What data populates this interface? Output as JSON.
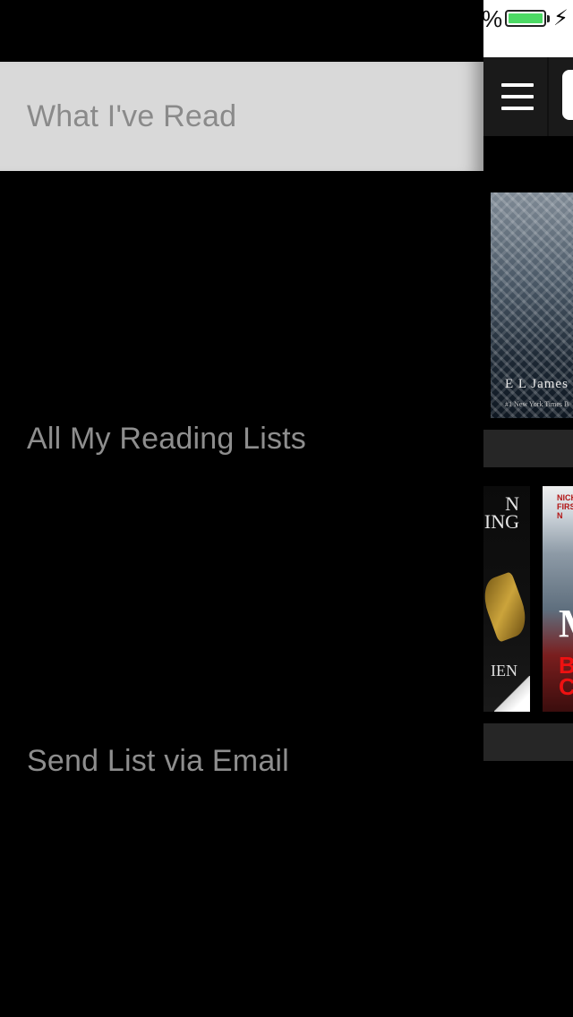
{
  "status_bar": {
    "battery_percent_fragment": "%",
    "battery_color": "#4cd964",
    "charging_icon": "bolt-icon"
  },
  "drawer": {
    "items": [
      {
        "label": "What I've Read",
        "selected": true
      },
      {
        "label": "All My Reading Lists",
        "selected": false
      },
      {
        "label": "Send List via Email",
        "selected": false
      }
    ]
  },
  "nav": {
    "menu_icon": "hamburger-icon"
  },
  "books": [
    {
      "author_fragment": "E L James",
      "tagline_fragment": "#1 New York Times B"
    },
    {
      "title_fragment_top": "N\nING",
      "title_fragment_bottom": "IEN"
    },
    {
      "top_fragment": "NICH\nFIRST\nN",
      "big_letter": "M",
      "red_fragment": "B\nC"
    }
  ],
  "colors": {
    "selected_row_bg": "#d9d9d9",
    "menu_text": "#8e8e8e",
    "shelf": "#262626"
  }
}
